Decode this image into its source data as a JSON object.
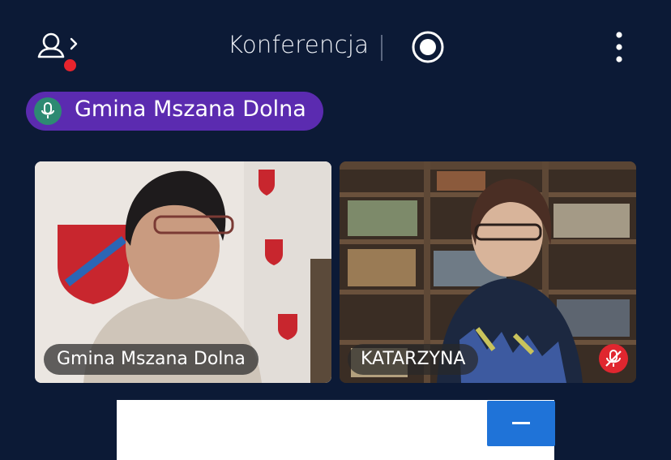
{
  "header": {
    "title": "Konferencja",
    "participants_icon": "participants-icon",
    "record_icon": "record-icon",
    "more_icon": "more-vertical-icon"
  },
  "active_speaker": {
    "icon": "microphone-icon",
    "name": "Gmina Mszana Dolna"
  },
  "tiles": [
    {
      "name": "Gmina Mszana Dolna"
    },
    {
      "name": "KATARZYNA",
      "status_icon": "muted-microphone-icon"
    }
  ],
  "colors": {
    "background": "#0c1a36",
    "speaker_pill": "#5b2bb0",
    "notification_dot": "#e8242d",
    "minimize_button": "#1f73d8"
  }
}
